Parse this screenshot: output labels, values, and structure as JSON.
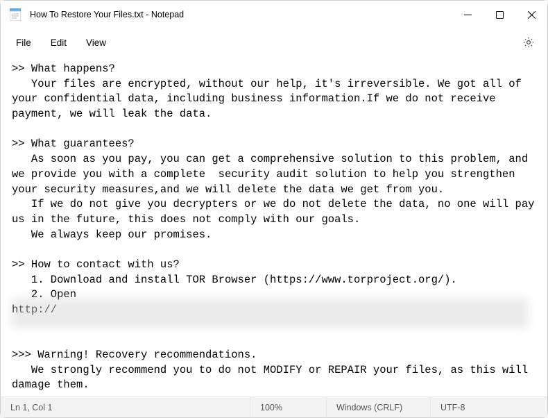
{
  "titlebar": {
    "title": "How To Restore Your Files.txt - Notepad"
  },
  "menu": {
    "file": "File",
    "edit": "Edit",
    "view": "View"
  },
  "document": {
    "text": ">> What happens?\n   Your files are encrypted, without our help, it's irreversible. We got all of your confidential data, including business information.If we do not receive payment, we will leak the data.\n\n>> What guarantees?\n   As soon as you pay, you can get a comprehensive solution to this problem, and we provide you with a complete  security audit solution to help you strengthen your security measures,and we will delete the data we get from you.\n   If we do not give you decrypters or we do not delete the data, no one will pay us in the future, this does not comply with our goals.\n   We always keep our promises.\n\n>> How to contact with us?\n   1. Download and install TOR Browser (https://www.torproject.org/).\n   2. Open\nhttp://\n\n\n>>> Warning! Recovery recommendations.\n   We strongly recommend you to do not MODIFY or REPAIR your files, as this will damage them."
  },
  "status": {
    "position": "Ln 1, Col 1",
    "zoom": "100%",
    "line_ending": "Windows (CRLF)",
    "encoding": "UTF-8"
  }
}
